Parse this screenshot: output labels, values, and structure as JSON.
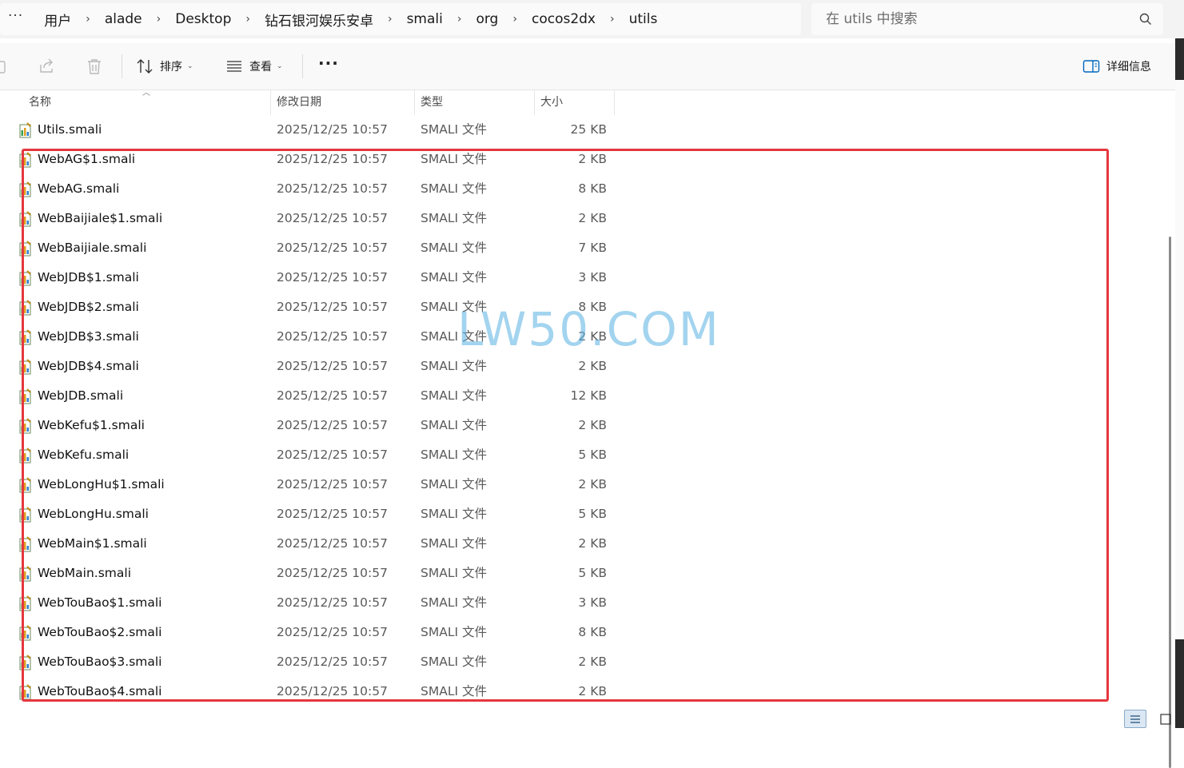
{
  "address_bar": {
    "more": "···",
    "crumbs": [
      "用户",
      "alade",
      "Desktop",
      "钻石银河娱乐安卓",
      "smali",
      "org",
      "cocos2dx",
      "utils"
    ],
    "chevron": "›"
  },
  "search": {
    "placeholder": "在 utils 中搜索"
  },
  "toolbar": {
    "sort_label": "排序",
    "view_label": "查看",
    "more": "···",
    "details_label": "详细信息"
  },
  "columns": {
    "name": "名称",
    "date": "修改日期",
    "type": "类型",
    "size": "大小"
  },
  "files": [
    {
      "name": "Utils.smali",
      "date": "2025/12/25 10:57",
      "type": "SMALI 文件",
      "size": "25 KB"
    },
    {
      "name": "WebAG$1.smali",
      "date": "2025/12/25 10:57",
      "type": "SMALI 文件",
      "size": "2 KB"
    },
    {
      "name": "WebAG.smali",
      "date": "2025/12/25 10:57",
      "type": "SMALI 文件",
      "size": "8 KB"
    },
    {
      "name": "WebBaijiale$1.smali",
      "date": "2025/12/25 10:57",
      "type": "SMALI 文件",
      "size": "2 KB"
    },
    {
      "name": "WebBaijiale.smali",
      "date": "2025/12/25 10:57",
      "type": "SMALI 文件",
      "size": "7 KB"
    },
    {
      "name": "WebJDB$1.smali",
      "date": "2025/12/25 10:57",
      "type": "SMALI 文件",
      "size": "3 KB"
    },
    {
      "name": "WebJDB$2.smali",
      "date": "2025/12/25 10:57",
      "type": "SMALI 文件",
      "size": "8 KB"
    },
    {
      "name": "WebJDB$3.smali",
      "date": "2025/12/25 10:57",
      "type": "SMALI 文件",
      "size": "2 KB"
    },
    {
      "name": "WebJDB$4.smali",
      "date": "2025/12/25 10:57",
      "type": "SMALI 文件",
      "size": "2 KB"
    },
    {
      "name": "WebJDB.smali",
      "date": "2025/12/25 10:57",
      "type": "SMALI 文件",
      "size": "12 KB"
    },
    {
      "name": "WebKefu$1.smali",
      "date": "2025/12/25 10:57",
      "type": "SMALI 文件",
      "size": "2 KB"
    },
    {
      "name": "WebKefu.smali",
      "date": "2025/12/25 10:57",
      "type": "SMALI 文件",
      "size": "5 KB"
    },
    {
      "name": "WebLongHu$1.smali",
      "date": "2025/12/25 10:57",
      "type": "SMALI 文件",
      "size": "2 KB"
    },
    {
      "name": "WebLongHu.smali",
      "date": "2025/12/25 10:57",
      "type": "SMALI 文件",
      "size": "5 KB"
    },
    {
      "name": "WebMain$1.smali",
      "date": "2025/12/25 10:57",
      "type": "SMALI 文件",
      "size": "2 KB"
    },
    {
      "name": "WebMain.smali",
      "date": "2025/12/25 10:57",
      "type": "SMALI 文件",
      "size": "5 KB"
    },
    {
      "name": "WebTouBao$1.smali",
      "date": "2025/12/25 10:57",
      "type": "SMALI 文件",
      "size": "3 KB"
    },
    {
      "name": "WebTouBao$2.smali",
      "date": "2025/12/25 10:57",
      "type": "SMALI 文件",
      "size": "8 KB"
    },
    {
      "name": "WebTouBao$3.smali",
      "date": "2025/12/25 10:57",
      "type": "SMALI 文件",
      "size": "2 KB"
    },
    {
      "name": "WebTouBao$4.smali",
      "date": "2025/12/25 10:57",
      "type": "SMALI 文件",
      "size": "2 KB"
    }
  ],
  "watermark": "LW50.COM",
  "colors": {
    "highlight": "#e5373d",
    "watermark": "#58b0e1",
    "accent": "#0067c0"
  }
}
